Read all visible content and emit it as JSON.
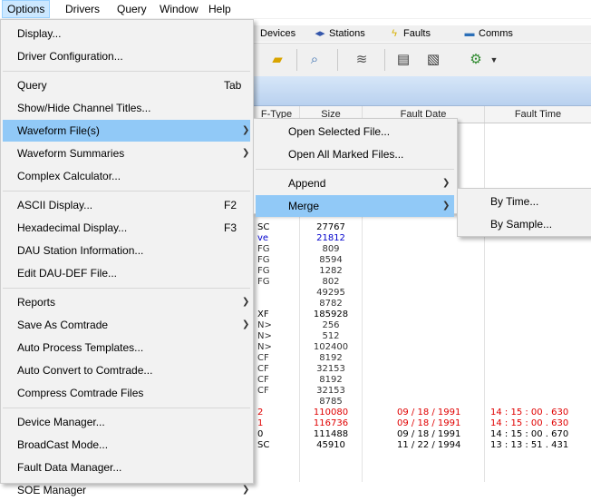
{
  "menubar": [
    "Options",
    "Drivers",
    "Query",
    "Window",
    "Help"
  ],
  "tabs": [
    {
      "label": "Devices",
      "icon": "devices-icon"
    },
    {
      "label": "Stations",
      "icon": "stations-icon"
    },
    {
      "label": "Faults",
      "icon": "faults-icon"
    },
    {
      "label": "Comms",
      "icon": "comms-icon"
    }
  ],
  "toolbar_icons": [
    "folder-icon",
    "search-icon",
    "waveform-icon",
    "document-icon",
    "document-edit-icon",
    "settings-gear-icon",
    "dropdown-arrow-icon"
  ],
  "grid_headers": [
    "F-Type",
    "Size",
    "Fault Date",
    "Fault Time"
  ],
  "grid_rows": [
    {
      "ftype": "SC",
      "size": "27767",
      "date": "",
      "time": "",
      "color": "#000000"
    },
    {
      "ftype": "ve",
      "size": "21812",
      "date": "",
      "time": "",
      "color": "#0000cc"
    },
    {
      "ftype": "FG",
      "size": "809",
      "date": "",
      "time": "",
      "color": "#333333"
    },
    {
      "ftype": "FG",
      "size": "8594",
      "date": "",
      "time": "",
      "color": "#333333"
    },
    {
      "ftype": "FG",
      "size": "1282",
      "date": "",
      "time": "",
      "color": "#333333"
    },
    {
      "ftype": "FG",
      "size": "802",
      "date": "",
      "time": "",
      "color": "#333333"
    },
    {
      "ftype": "",
      "size": "49295",
      "date": "",
      "time": "",
      "color": "#333333"
    },
    {
      "ftype": "",
      "size": "8782",
      "date": "",
      "time": "",
      "color": "#333333"
    },
    {
      "ftype": "XF",
      "size": "185928",
      "date": "",
      "time": "",
      "color": "#000000"
    },
    {
      "ftype": "N>",
      "size": "256",
      "date": "",
      "time": "",
      "color": "#333333"
    },
    {
      "ftype": "N>",
      "size": "512",
      "date": "",
      "time": "",
      "color": "#333333"
    },
    {
      "ftype": "N>",
      "size": "102400",
      "date": "",
      "time": "",
      "color": "#333333"
    },
    {
      "ftype": "CF",
      "size": "8192",
      "date": "",
      "time": "",
      "color": "#333333"
    },
    {
      "ftype": "CF",
      "size": "32153",
      "date": "",
      "time": "",
      "color": "#333333"
    },
    {
      "ftype": "CF",
      "size": "8192",
      "date": "",
      "time": "",
      "color": "#333333"
    },
    {
      "ftype": "CF",
      "size": "32153",
      "date": "",
      "time": "",
      "color": "#333333"
    },
    {
      "ftype": "",
      "size": "8785",
      "date": "",
      "time": "",
      "color": "#333333"
    },
    {
      "ftype": "2",
      "size": "110080",
      "date": "09 / 18 / 1991",
      "time": "14 : 15 : 00 . 630",
      "color": "#e00000"
    },
    {
      "ftype": "1",
      "size": "116736",
      "date": "09 / 18 / 1991",
      "time": "14 : 15 : 00 . 630",
      "color": "#e00000"
    },
    {
      "ftype": "0",
      "size": "111488",
      "date": "09 / 18 / 1991",
      "time": "14 : 15 : 00 . 670",
      "color": "#000000"
    },
    {
      "ftype": "SC",
      "size": "45910",
      "date": "11 / 22 / 1994",
      "time": "13 : 13 : 51 . 431",
      "color": "#000000"
    }
  ],
  "options_menu": [
    {
      "label": "Display...",
      "shortcut": "",
      "submenu": false
    },
    {
      "label": "Driver Configuration...",
      "shortcut": "",
      "submenu": false,
      "sep_after": true
    },
    {
      "label": "Query",
      "shortcut": "Tab",
      "submenu": false
    },
    {
      "label": "Show/Hide Channel Titles...",
      "shortcut": "",
      "submenu": false
    },
    {
      "label": "Waveform File(s)",
      "shortcut": "",
      "submenu": true,
      "highlighted": true
    },
    {
      "label": "Waveform Summaries",
      "shortcut": "",
      "submenu": true
    },
    {
      "label": "Complex Calculator...",
      "shortcut": "",
      "submenu": false,
      "sep_after": true
    },
    {
      "label": "ASCII Display...",
      "shortcut": "F2",
      "submenu": false
    },
    {
      "label": "Hexadecimal Display...",
      "shortcut": "F3",
      "submenu": false
    },
    {
      "label": "DAU Station Information...",
      "shortcut": "",
      "submenu": false
    },
    {
      "label": "Edit DAU-DEF File...",
      "shortcut": "",
      "submenu": false,
      "sep_after": true
    },
    {
      "label": "Reports",
      "shortcut": "",
      "submenu": true
    },
    {
      "label": "Save As Comtrade",
      "shortcut": "",
      "submenu": true
    },
    {
      "label": "Auto Process Templates...",
      "shortcut": "",
      "submenu": false
    },
    {
      "label": "Auto Convert to Comtrade...",
      "shortcut": "",
      "submenu": false
    },
    {
      "label": "Compress Comtrade Files",
      "shortcut": "",
      "submenu": false,
      "sep_after": true
    },
    {
      "label": "Device Manager...",
      "shortcut": "",
      "submenu": false
    },
    {
      "label": "BroadCast Mode...",
      "shortcut": "",
      "submenu": false
    },
    {
      "label": "Fault Data Manager...",
      "shortcut": "",
      "submenu": false
    },
    {
      "label": "SOE Manager",
      "shortcut": "",
      "submenu": true
    }
  ],
  "waveform_menu": [
    {
      "label": "Open Selected File...",
      "submenu": false
    },
    {
      "label": "Open All Marked Files...",
      "submenu": false,
      "sep_after": true
    },
    {
      "label": "Append",
      "submenu": true
    },
    {
      "label": "Merge",
      "submenu": true,
      "highlighted": true
    }
  ],
  "merge_menu": [
    {
      "label": "By Time..."
    },
    {
      "label": "By Sample..."
    }
  ],
  "colors": {
    "menu_highlight": "#91c9f7",
    "menubar_active": "#cce8ff",
    "red_text": "#e00000",
    "blue_text": "#0000cc"
  }
}
